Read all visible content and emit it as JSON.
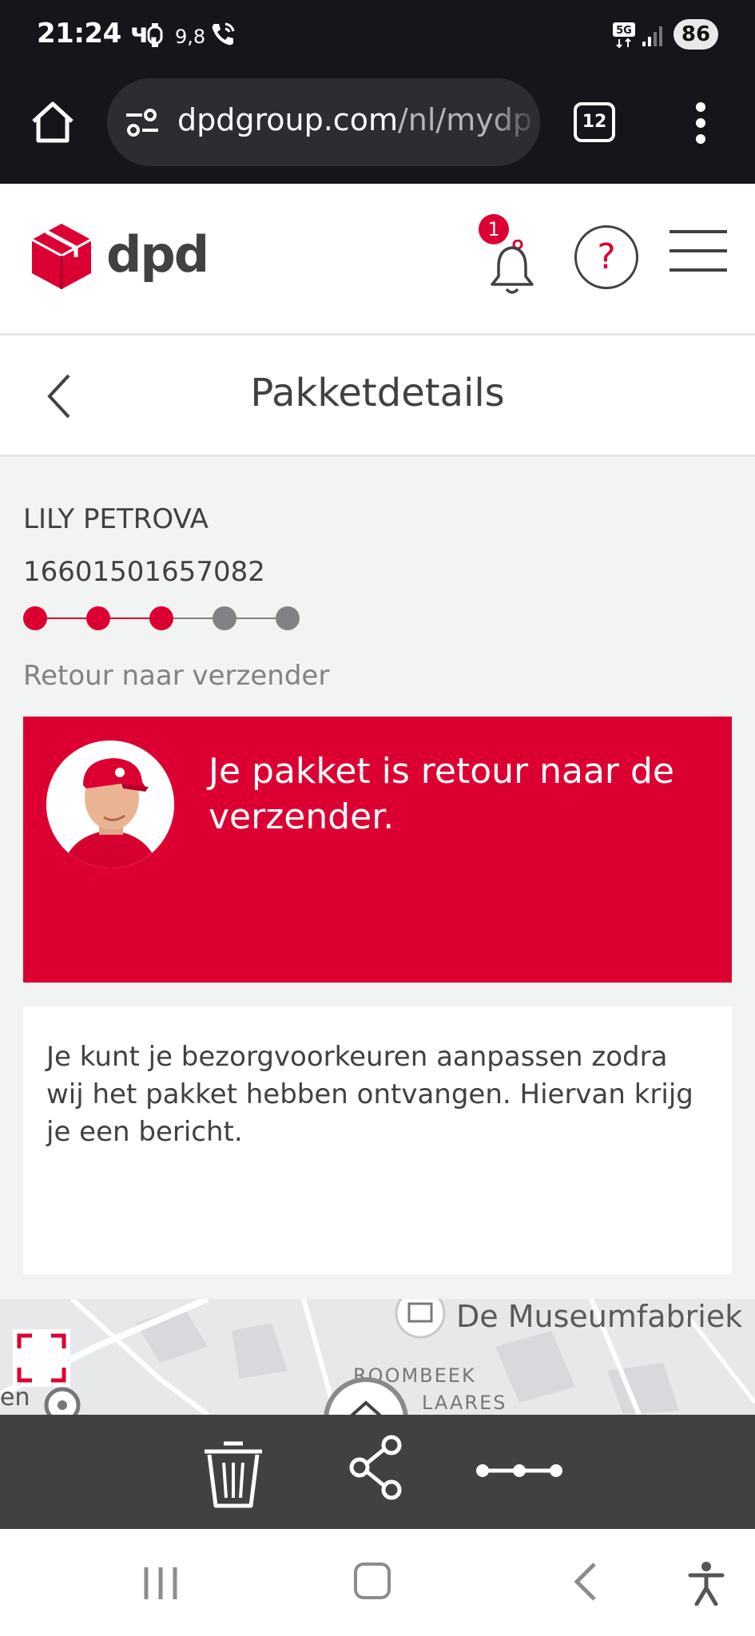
{
  "status_bar": {
    "time": "21:24 ч.",
    "temperature": "9,8",
    "network": "5G",
    "battery": "86",
    "icons": [
      "watch-icon",
      "wifi-call-icon",
      "signal-icon"
    ]
  },
  "browser": {
    "url_main": "dpdgroup.com",
    "url_rest": "/nl/mydp",
    "tab_count": "12",
    "icons": [
      "home-icon",
      "site-settings-icon",
      "more-vert-icon"
    ]
  },
  "header": {
    "logo_text": "dpd",
    "notification_count": "1",
    "help_symbol": "?",
    "icons": [
      "dpd-cube-logo",
      "bell-icon",
      "help-icon",
      "hamburger-menu-icon"
    ],
    "brand_color": "#dc0032"
  },
  "page": {
    "title": "Pakketdetails",
    "back_icon": "chevron-left-icon"
  },
  "parcel": {
    "recipient": "LILY PETROVA",
    "tracking_number": "16601501657082",
    "progress": {
      "total_steps": 5,
      "completed_steps": 3,
      "active_color": "#dc0032",
      "inactive_color": "#808285"
    },
    "status": "Retour naar verzender"
  },
  "alert_card": {
    "message": "Je pakket is retour naar de verzender.",
    "avatar": "dpd-courier-avatar",
    "background": "#dc0032"
  },
  "info_card": {
    "message": "Je kunt je bezorgvoorkeuren aanpassen zodra wij het pakket hebben ontvangen. Hiervan krijg je een bericht."
  },
  "map": {
    "poi_name": "De Museumfabriek",
    "district_1": "ROOMBEEK",
    "district_2": "LAARES",
    "partial_label": "en",
    "icons": [
      "fullscreen-icon",
      "museum-icon",
      "chevron-up-icon"
    ]
  },
  "action_bar": {
    "icons": [
      "trash-icon",
      "share-icon",
      "tracking-steps-icon"
    ]
  },
  "nav_bar": {
    "icons": [
      "recents-icon",
      "home-nav-icon",
      "back-nav-icon",
      "accessibility-icon"
    ]
  }
}
